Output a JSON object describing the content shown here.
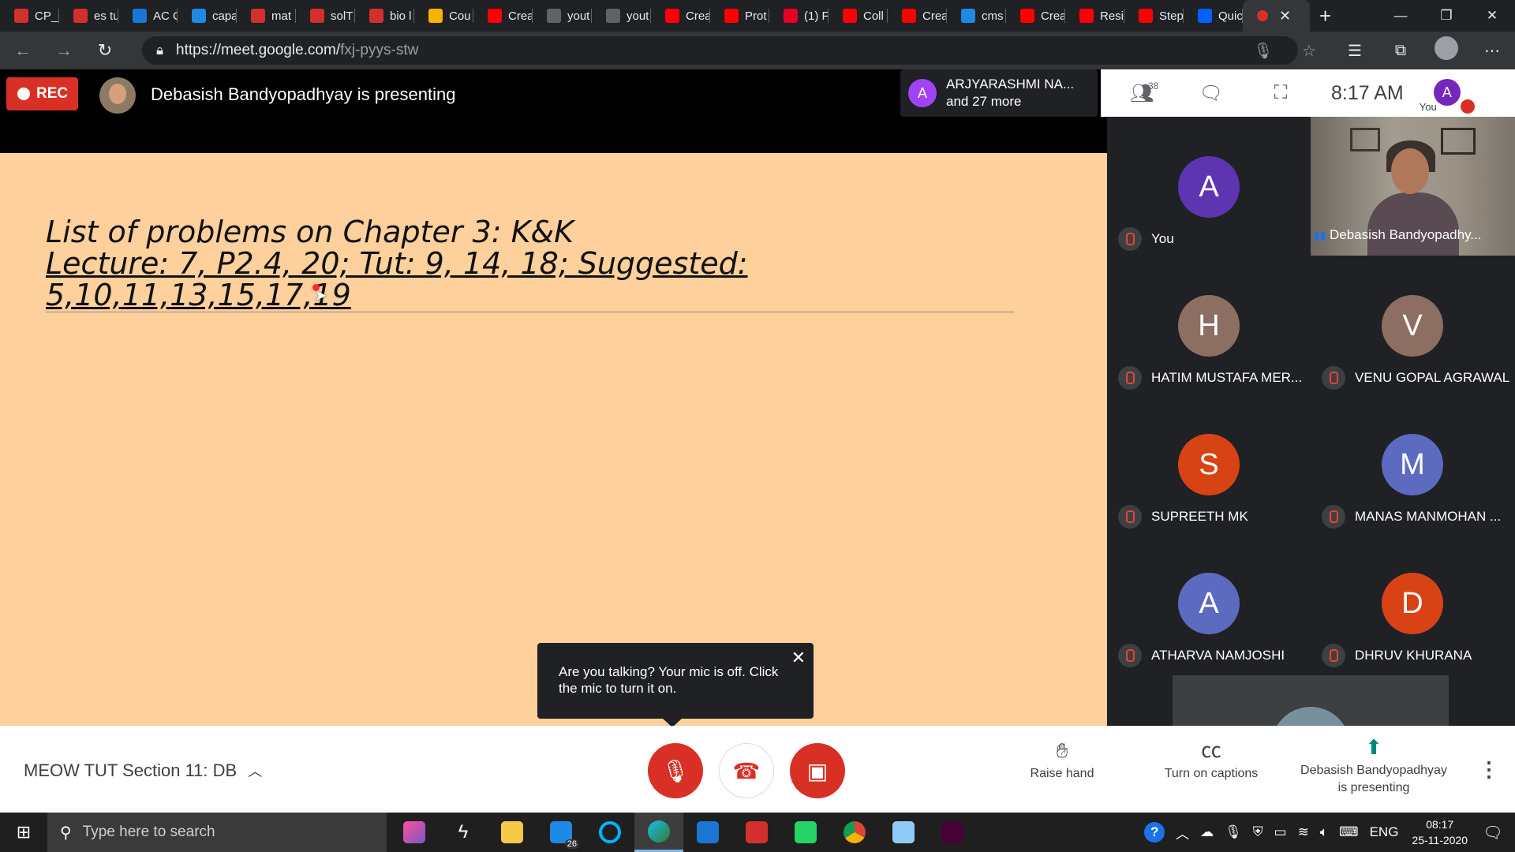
{
  "browser": {
    "tabs": [
      {
        "title": "CP_I",
        "icon": "pdf-icon",
        "color": "#d32f2f"
      },
      {
        "title": "es tu",
        "icon": "pdf-icon",
        "color": "#d32f2f"
      },
      {
        "title": "AC C",
        "icon": "edge-e-icon",
        "color": "#1976d2"
      },
      {
        "title": "capa",
        "icon": "bing-icon",
        "color": "#1e88e5"
      },
      {
        "title": "mat",
        "icon": "pdf-icon",
        "color": "#d32f2f"
      },
      {
        "title": "solT",
        "icon": "pdf-icon",
        "color": "#d32f2f"
      },
      {
        "title": "bio l",
        "icon": "pdf-icon",
        "color": "#d32f2f"
      },
      {
        "title": "Cou",
        "icon": "classroom-icon",
        "color": "#f4b400"
      },
      {
        "title": "Crea",
        "icon": "youtube-icon",
        "color": "#ff0000"
      },
      {
        "title": "yout",
        "icon": "page-icon",
        "color": "#5f6368"
      },
      {
        "title": "yout",
        "icon": "page-icon",
        "color": "#5f6368"
      },
      {
        "title": "Crea",
        "icon": "youtube-icon",
        "color": "#ff0000"
      },
      {
        "title": "Prot",
        "icon": "youtube-icon",
        "color": "#ff0000"
      },
      {
        "title": "(1) F",
        "icon": "pinterest-icon",
        "color": "#e60023"
      },
      {
        "title": "Coll",
        "icon": "youtube-icon",
        "color": "#ff0000"
      },
      {
        "title": "Crea",
        "icon": "youtube-icon",
        "color": "#ff0000"
      },
      {
        "title": "cms",
        "icon": "bing-icon",
        "color": "#1e88e5"
      },
      {
        "title": "Crea",
        "icon": "youtube-icon",
        "color": "#ff0000"
      },
      {
        "title": "Resi",
        "icon": "youtube-icon",
        "color": "#ff0000"
      },
      {
        "title": "Step",
        "icon": "youtube-icon",
        "color": "#ff0000"
      },
      {
        "title": "Quic",
        "icon": "dropbox-icon",
        "color": "#0061fe"
      }
    ],
    "active_tab_icon": "record-icon",
    "url_host": "https://meet.google.com/",
    "url_path": "fxj-pyys-stw"
  },
  "meet": {
    "rec_label": "REC",
    "presenting_banner": "Debasish Bandyopadhyay is presenting",
    "join_chip": {
      "initial": "A",
      "line1": "ARJYARASHMI NA...",
      "line2": "and 27 more"
    },
    "participant_count": "38",
    "clock": "8:17 AM",
    "you_initial": "A",
    "you_label": "You",
    "slide": {
      "line1": "List of problems on Chapter 3: K&K",
      "line2": "Lecture: 7, P2.4, 20; Tut: 9, 14, 18; Suggested:",
      "line3": "5,10,11,13,15,17,19"
    },
    "tooltip": "Are you talking? Your mic is off. Click the mic to turn it on.",
    "participants": [
      {
        "initial": "A",
        "name": "You",
        "color": "#5e35b1"
      },
      {
        "initial": "H",
        "name": "HATIM MUSTAFA MER...",
        "color": "#8d6e63"
      },
      {
        "initial": "V",
        "name": "VENU GOPAL AGRAWAL",
        "color": "#8d6e63"
      },
      {
        "initial": "S",
        "name": "SUPREETH MK",
        "color": "#d84315"
      },
      {
        "initial": "M",
        "name": "MANAS MANMOHAN ...",
        "color": "#5c6bc0"
      },
      {
        "initial": "A",
        "name": "ATHARVA NAMJOSHI",
        "color": "#5c6bc0"
      },
      {
        "initial": "D",
        "name": "DHRUV KHURANA",
        "color": "#d84315"
      }
    ],
    "video_tile_name": "Debasish Bandyopadhy...",
    "meeting_name": "MEOW TUT Section 11: DB",
    "raise_hand": "Raise hand",
    "captions": "Turn on captions",
    "presenting_line1": "Debasish Bandyopadhyay",
    "presenting_line2": "is presenting"
  },
  "taskbar": {
    "search_placeholder": "Type here to search",
    "mail_badge": "26",
    "lang": "ENG",
    "time": "08:17",
    "date": "25-11-2020"
  }
}
